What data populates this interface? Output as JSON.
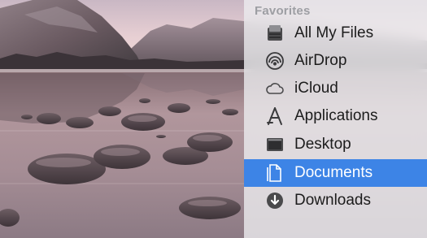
{
  "sidebar": {
    "section_title": "Favorites",
    "selected_item": "Documents",
    "accent_color": "#3d84e6",
    "items": [
      {
        "label": "All My Files",
        "icon": "all-my-files-icon"
      },
      {
        "label": "AirDrop",
        "icon": "airdrop-icon"
      },
      {
        "label": "iCloud",
        "icon": "icloud-icon"
      },
      {
        "label": "Applications",
        "icon": "applications-icon"
      },
      {
        "label": "Desktop",
        "icon": "desktop-icon"
      },
      {
        "label": "Documents",
        "icon": "documents-icon"
      },
      {
        "label": "Downloads",
        "icon": "downloads-icon"
      }
    ]
  }
}
